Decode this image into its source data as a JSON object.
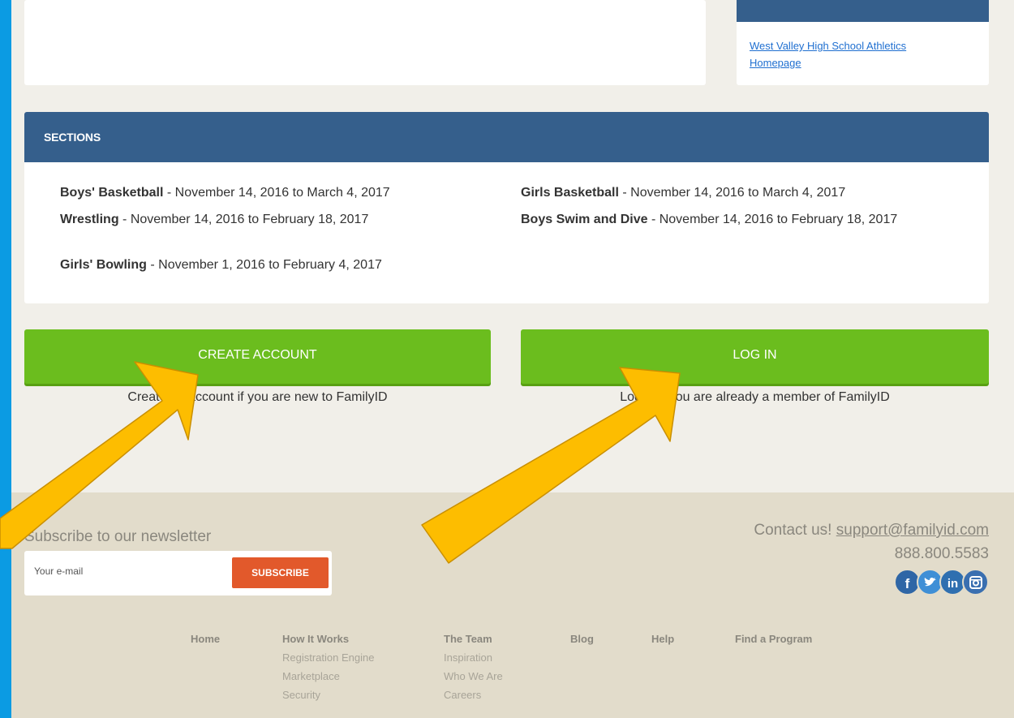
{
  "top_right": {
    "link_line1": "West Valley High School Athletics",
    "link_line2": "Homepage"
  },
  "sections": {
    "title": "SECTIONS",
    "items": [
      {
        "name": "Boys' Basketball",
        "dates": " - November 14, 2016 to March 4, 2017"
      },
      {
        "name": "Girls Basketball",
        "dates": " - November 14, 2016 to March 4, 2017"
      },
      {
        "name": "Wrestling",
        "dates": " - November 14, 2016 to February 18, 2017"
      },
      {
        "name": "Boys Swim and Dive",
        "dates": " - November 14, 2016 to February 18, 2017"
      },
      {
        "name": "Girls' Bowling",
        "dates": " - November 1, 2016 to February 4, 2017"
      }
    ]
  },
  "actions": {
    "create_label": "CREATE ACCOUNT",
    "create_caption": "Create an account if you are new to FamilyID",
    "login_label": "LOG IN",
    "login_caption": "Log in if you are already a member of FamilyID"
  },
  "footer": {
    "newsletter_title": "Subscribe to our newsletter",
    "email_placeholder": "Your e-mail",
    "subscribe_label": "SUBSCRIBE",
    "contact_prefix": "Contact us! ",
    "contact_email": "support@familyid.com",
    "phone": "888.800.5583",
    "social": [
      "facebook-icon",
      "twitter-icon",
      "linkedin-icon",
      "instagram-icon"
    ],
    "nav": {
      "home": "Home",
      "how_it_works": "How It Works",
      "how_sub": [
        "Registration Engine",
        "Marketplace",
        "Security"
      ],
      "team": "The Team",
      "team_sub": [
        "Inspiration",
        "Who We Are",
        "Careers"
      ],
      "blog": "Blog",
      "help": "Help",
      "find": "Find a Program"
    }
  },
  "colors": {
    "frame_blue": "#0b9be3",
    "header_blue": "#355f8c",
    "button_green": "#6bbd1e",
    "subscribe_orange": "#e2592b",
    "arrow_yellow": "#fdbd00"
  }
}
